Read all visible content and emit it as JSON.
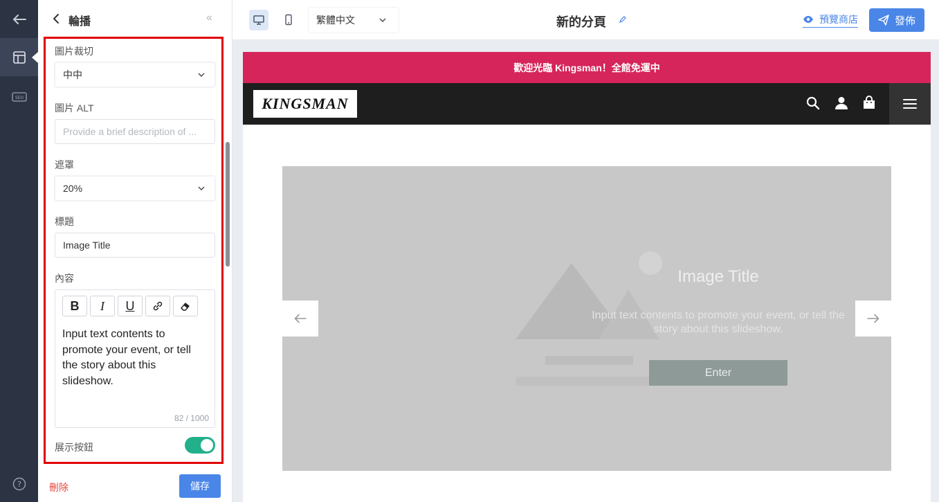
{
  "panel": {
    "title": "輪播",
    "collapse_symbol": "«",
    "fields": {
      "crop_label": "圖片裁切",
      "crop_value": "中中",
      "alt_label": "圖片 ALT",
      "alt_placeholder": "Provide a brief description of ...",
      "mask_label": "遮罩",
      "mask_value": "20%",
      "title_label": "標題",
      "title_value": "Image Title",
      "content_label": "內容",
      "content_value": "Input text contents to promote your event, or tell the story about this slideshow.",
      "content_counter": "82 / 1000",
      "show_button_label": "展示按鈕",
      "show_button_on": true
    },
    "toolbar": [
      "B",
      "I",
      "U",
      "link-icon",
      "eraser-icon"
    ],
    "delete_label": "刪除",
    "save_label": "儲存"
  },
  "topbar": {
    "language": "繁體中文",
    "page_title": "新的分頁",
    "preview_label": "預覽商店",
    "publish_label": "發佈"
  },
  "store": {
    "announcement": "歡迎光臨 Kingsman！全館免運中",
    "logo_text": "KINGSMAN",
    "slide": {
      "title": "Image Title",
      "text": "Input text contents to promote your event, or tell the story about this slideshow.",
      "button": "Enter"
    }
  },
  "colors": {
    "rail": "#2c3444",
    "accent": "#4a86e8",
    "announcement": "#d6255a",
    "toggle_on": "#22b08b",
    "highlight": "#e00000"
  }
}
